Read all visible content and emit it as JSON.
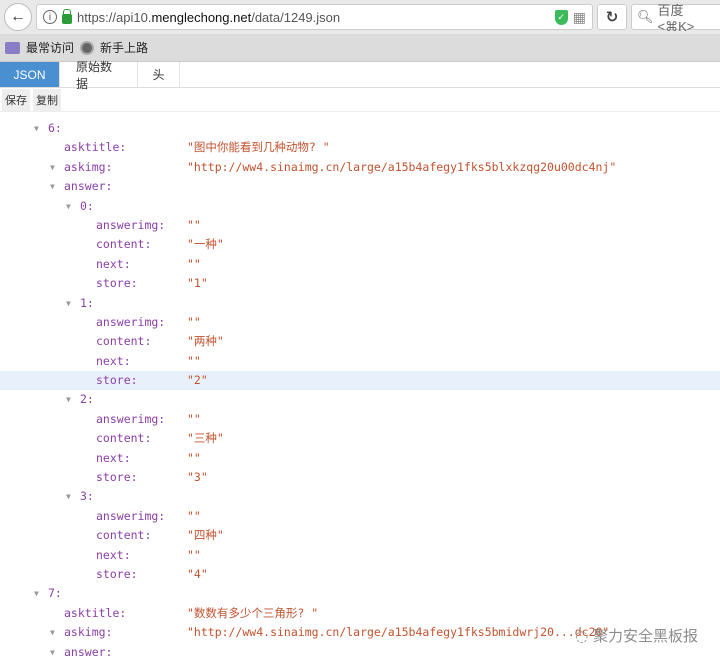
{
  "browser": {
    "url_prefix": "https://api10.",
    "url_domain": "menglechong.net",
    "url_path": "/data/1249.json",
    "search_placeholder": "百度 <⌘K>"
  },
  "bookmarks": [
    "最常访问",
    "新手上路"
  ],
  "tabs": [
    "JSON",
    "原始数据",
    "头"
  ],
  "toolbar": {
    "save": "保存",
    "copy": "复制"
  },
  "tree": [
    {
      "key": "6:",
      "open": true,
      "children": [
        {
          "key": "asktitle:",
          "value": "\"图中你能看到几种动物? \""
        },
        {
          "key": "askimg:",
          "open": true,
          "value": "\"http://ww4.sinaimg.cn/large/a15b4afegy1fks5blxkzqg20u00dc4nj\""
        },
        {
          "key": "answer:",
          "open": true,
          "children": [
            {
              "key": "0:",
              "open": true,
              "children": [
                {
                  "key": "answerimg:",
                  "value": "\"\""
                },
                {
                  "key": "content:",
                  "value": "\"一种\""
                },
                {
                  "key": "next:",
                  "value": "\"\""
                },
                {
                  "key": "store:",
                  "value": "\"1\""
                }
              ]
            },
            {
              "key": "1:",
              "open": true,
              "children": [
                {
                  "key": "answerimg:",
                  "value": "\"\""
                },
                {
                  "key": "content:",
                  "value": "\"两种\""
                },
                {
                  "key": "next:",
                  "value": "\"\""
                },
                {
                  "key": "store:",
                  "value": "\"2\"",
                  "highlighted": true
                }
              ]
            },
            {
              "key": "2:",
              "open": true,
              "children": [
                {
                  "key": "answerimg:",
                  "value": "\"\""
                },
                {
                  "key": "content:",
                  "value": "\"三种\""
                },
                {
                  "key": "next:",
                  "value": "\"\""
                },
                {
                  "key": "store:",
                  "value": "\"3\""
                }
              ]
            },
            {
              "key": "3:",
              "open": true,
              "children": [
                {
                  "key": "answerimg:",
                  "value": "\"\""
                },
                {
                  "key": "content:",
                  "value": "\"四种\""
                },
                {
                  "key": "next:",
                  "value": "\"\""
                },
                {
                  "key": "store:",
                  "value": "\"4\""
                }
              ]
            }
          ]
        }
      ]
    },
    {
      "key": "7:",
      "open": true,
      "children": [
        {
          "key": "asktitle:",
          "value": "\"数数有多少个三角形? \""
        },
        {
          "key": "askimg:",
          "open": true,
          "value": "\"http://ww4.sinaimg.cn/large/a15b4afegy1fks5bmidwrj20...dc20\""
        },
        {
          "key": "answer:",
          "open": true,
          "children": []
        }
      ]
    }
  ],
  "watermark": "安全黑板报"
}
